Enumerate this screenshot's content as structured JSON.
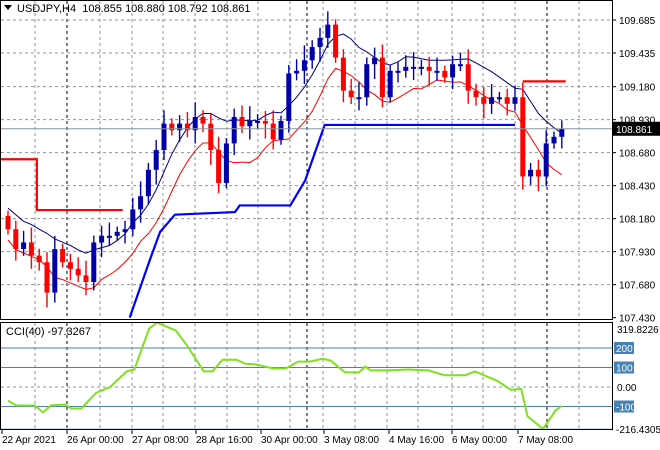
{
  "header": {
    "symbol": "USDJPY,H4",
    "open": "108.855",
    "high": "108.880",
    "low": "108.792",
    "close": "108.861"
  },
  "price_axis": {
    "labels": [
      "109.685",
      "109.435",
      "109.180",
      "108.930",
      "108.680",
      "108.430",
      "108.180",
      "107.930",
      "107.680",
      "107.430"
    ],
    "current_price": "108.861"
  },
  "cci": {
    "title": "CCI(40) -97.3267",
    "max_label": "319.8226",
    "min_label": "-216.4305",
    "levels": [
      "200",
      "100",
      "0.00",
      "-100"
    ]
  },
  "time_axis": [
    "22 Apr 2021",
    "26 Apr 00:00",
    "27 Apr 08:00",
    "28 Apr 16:00",
    "30 Apr 00:00",
    "3 May 08:00",
    "4 May 16:00",
    "6 May 00:00",
    "7 May 08:00"
  ],
  "colors": {
    "bull": "#0000a8",
    "bear": "#ff0000",
    "ma_upper": "#000080",
    "ma_lower": "#ff0000",
    "stop_blue": "#0000ff",
    "cci_line": "#7fe020",
    "level": "#4682b4",
    "grid": "#8a96a0"
  },
  "chart_data": {
    "type": "candlestick",
    "symbol": "USDJPY",
    "timeframe": "H4",
    "price_range": [
      107.43,
      109.685
    ],
    "first_open": 108.2,
    "closes": [
      108.1,
      107.95,
      108.0,
      107.9,
      107.85,
      107.62,
      107.95,
      107.85,
      107.8,
      107.75,
      107.7,
      108.0,
      108.05,
      108.05,
      108.08,
      108.1,
      108.25,
      108.35,
      108.55,
      108.7,
      108.9,
      108.85,
      108.9,
      108.85,
      108.95,
      108.9,
      108.7,
      108.45,
      108.75,
      108.95,
      108.88,
      108.92,
      108.92,
      108.9,
      108.78,
      108.92,
      109.28,
      109.3,
      109.38,
      109.48,
      109.55,
      109.65,
      109.4,
      109.15,
      109.1,
      109.1,
      109.35,
      109.4,
      109.1,
      109.3,
      109.3,
      109.33,
      109.33,
      109.33,
      109.3,
      109.3,
      109.25,
      109.35,
      109.35,
      109.15,
      109.1,
      109.05,
      109.1,
      109.1,
      109.05,
      109.1,
      108.5,
      108.55,
      108.5,
      108.75,
      108.8,
      108.861
    ],
    "blue_stop_line": [
      [
        15.6,
        107.43
      ],
      [
        18.2,
        107.87
      ],
      [
        19.5,
        108.08
      ],
      [
        21.4,
        108.21
      ],
      [
        29.1,
        108.23
      ],
      [
        29.7,
        108.28
      ],
      [
        36.2,
        108.28
      ],
      [
        38.1,
        108.47
      ],
      [
        40.6,
        108.89
      ],
      [
        65,
        108.89
      ]
    ],
    "red_stop_lines": [
      [
        [
          -1,
          108.63
        ],
        [
          3.7,
          108.63
        ],
        [
          3.7,
          108.245
        ],
        [
          14.7,
          108.245
        ]
      ],
      [
        [
          66,
          109.22
        ],
        [
          71.5,
          109.22
        ]
      ]
    ],
    "cci_range": [
      -216.4305,
      319.8226
    ],
    "cci_points": [
      [
        0,
        -70
      ],
      [
        1.1,
        -95
      ],
      [
        3.4,
        -95
      ],
      [
        4.5,
        -130
      ],
      [
        5.5,
        -95
      ],
      [
        7.3,
        -90
      ],
      [
        8.1,
        -110
      ],
      [
        9.4,
        -110
      ],
      [
        11.3,
        -30
      ],
      [
        13.1,
        0
      ],
      [
        15.2,
        80
      ],
      [
        16.2,
        90
      ],
      [
        18.1,
        300
      ],
      [
        19.1,
        330
      ],
      [
        21.5,
        290
      ],
      [
        23,
        210
      ],
      [
        25.1,
        80
      ],
      [
        26.2,
        80
      ],
      [
        27.5,
        140
      ],
      [
        29.3,
        140
      ],
      [
        30.4,
        120
      ],
      [
        31.9,
        115
      ],
      [
        34,
        95
      ],
      [
        35.6,
        95
      ],
      [
        37.2,
        130
      ],
      [
        38.7,
        130
      ],
      [
        40.3,
        145
      ],
      [
        41.4,
        135
      ],
      [
        43.2,
        75
      ],
      [
        45,
        75
      ],
      [
        45.8,
        105
      ],
      [
        46.5,
        85
      ],
      [
        48.7,
        85
      ],
      [
        51.3,
        90
      ],
      [
        53.9,
        85
      ],
      [
        56,
        60
      ],
      [
        58.6,
        60
      ],
      [
        59.9,
        80
      ],
      [
        62.8,
        30
      ],
      [
        64.5,
        -15
      ],
      [
        65.8,
        -10
      ],
      [
        66.6,
        -150
      ],
      [
        68.6,
        -215
      ],
      [
        70.2,
        -120
      ],
      [
        71,
        -97.33
      ]
    ]
  }
}
